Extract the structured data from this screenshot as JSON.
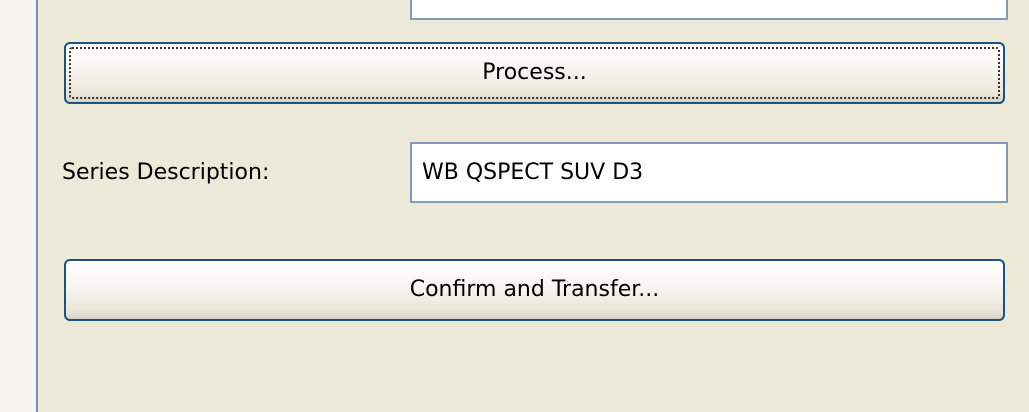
{
  "process_button": {
    "label": "Process..."
  },
  "series_description": {
    "label": "Series Description:",
    "value": "WB QSPECT SUV D3"
  },
  "confirm_button": {
    "label": "Confirm and Transfer..."
  },
  "colors": {
    "panel_bg": "#ece9d8",
    "button_border": "#1c5180",
    "field_border": "#7f9db9",
    "panel_edge": "#6f93b2"
  }
}
